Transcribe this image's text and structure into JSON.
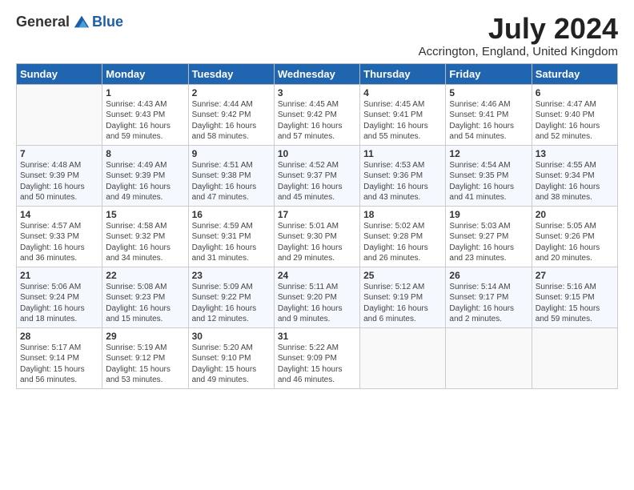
{
  "logo": {
    "general": "General",
    "blue": "Blue"
  },
  "title": "July 2024",
  "location": "Accrington, England, United Kingdom",
  "days_header": [
    "Sunday",
    "Monday",
    "Tuesday",
    "Wednesday",
    "Thursday",
    "Friday",
    "Saturday"
  ],
  "weeks": [
    [
      {
        "day": "",
        "sunrise": "",
        "sunset": "",
        "daylight": ""
      },
      {
        "day": "1",
        "sunrise": "Sunrise: 4:43 AM",
        "sunset": "Sunset: 9:43 PM",
        "daylight": "Daylight: 16 hours and 59 minutes."
      },
      {
        "day": "2",
        "sunrise": "Sunrise: 4:44 AM",
        "sunset": "Sunset: 9:42 PM",
        "daylight": "Daylight: 16 hours and 58 minutes."
      },
      {
        "day": "3",
        "sunrise": "Sunrise: 4:45 AM",
        "sunset": "Sunset: 9:42 PM",
        "daylight": "Daylight: 16 hours and 57 minutes."
      },
      {
        "day": "4",
        "sunrise": "Sunrise: 4:45 AM",
        "sunset": "Sunset: 9:41 PM",
        "daylight": "Daylight: 16 hours and 55 minutes."
      },
      {
        "day": "5",
        "sunrise": "Sunrise: 4:46 AM",
        "sunset": "Sunset: 9:41 PM",
        "daylight": "Daylight: 16 hours and 54 minutes."
      },
      {
        "day": "6",
        "sunrise": "Sunrise: 4:47 AM",
        "sunset": "Sunset: 9:40 PM",
        "daylight": "Daylight: 16 hours and 52 minutes."
      }
    ],
    [
      {
        "day": "7",
        "sunrise": "Sunrise: 4:48 AM",
        "sunset": "Sunset: 9:39 PM",
        "daylight": "Daylight: 16 hours and 50 minutes."
      },
      {
        "day": "8",
        "sunrise": "Sunrise: 4:49 AM",
        "sunset": "Sunset: 9:39 PM",
        "daylight": "Daylight: 16 hours and 49 minutes."
      },
      {
        "day": "9",
        "sunrise": "Sunrise: 4:51 AM",
        "sunset": "Sunset: 9:38 PM",
        "daylight": "Daylight: 16 hours and 47 minutes."
      },
      {
        "day": "10",
        "sunrise": "Sunrise: 4:52 AM",
        "sunset": "Sunset: 9:37 PM",
        "daylight": "Daylight: 16 hours and 45 minutes."
      },
      {
        "day": "11",
        "sunrise": "Sunrise: 4:53 AM",
        "sunset": "Sunset: 9:36 PM",
        "daylight": "Daylight: 16 hours and 43 minutes."
      },
      {
        "day": "12",
        "sunrise": "Sunrise: 4:54 AM",
        "sunset": "Sunset: 9:35 PM",
        "daylight": "Daylight: 16 hours and 41 minutes."
      },
      {
        "day": "13",
        "sunrise": "Sunrise: 4:55 AM",
        "sunset": "Sunset: 9:34 PM",
        "daylight": "Daylight: 16 hours and 38 minutes."
      }
    ],
    [
      {
        "day": "14",
        "sunrise": "Sunrise: 4:57 AM",
        "sunset": "Sunset: 9:33 PM",
        "daylight": "Daylight: 16 hours and 36 minutes."
      },
      {
        "day": "15",
        "sunrise": "Sunrise: 4:58 AM",
        "sunset": "Sunset: 9:32 PM",
        "daylight": "Daylight: 16 hours and 34 minutes."
      },
      {
        "day": "16",
        "sunrise": "Sunrise: 4:59 AM",
        "sunset": "Sunset: 9:31 PM",
        "daylight": "Daylight: 16 hours and 31 minutes."
      },
      {
        "day": "17",
        "sunrise": "Sunrise: 5:01 AM",
        "sunset": "Sunset: 9:30 PM",
        "daylight": "Daylight: 16 hours and 29 minutes."
      },
      {
        "day": "18",
        "sunrise": "Sunrise: 5:02 AM",
        "sunset": "Sunset: 9:28 PM",
        "daylight": "Daylight: 16 hours and 26 minutes."
      },
      {
        "day": "19",
        "sunrise": "Sunrise: 5:03 AM",
        "sunset": "Sunset: 9:27 PM",
        "daylight": "Daylight: 16 hours and 23 minutes."
      },
      {
        "day": "20",
        "sunrise": "Sunrise: 5:05 AM",
        "sunset": "Sunset: 9:26 PM",
        "daylight": "Daylight: 16 hours and 20 minutes."
      }
    ],
    [
      {
        "day": "21",
        "sunrise": "Sunrise: 5:06 AM",
        "sunset": "Sunset: 9:24 PM",
        "daylight": "Daylight: 16 hours and 18 minutes."
      },
      {
        "day": "22",
        "sunrise": "Sunrise: 5:08 AM",
        "sunset": "Sunset: 9:23 PM",
        "daylight": "Daylight: 16 hours and 15 minutes."
      },
      {
        "day": "23",
        "sunrise": "Sunrise: 5:09 AM",
        "sunset": "Sunset: 9:22 PM",
        "daylight": "Daylight: 16 hours and 12 minutes."
      },
      {
        "day": "24",
        "sunrise": "Sunrise: 5:11 AM",
        "sunset": "Sunset: 9:20 PM",
        "daylight": "Daylight: 16 hours and 9 minutes."
      },
      {
        "day": "25",
        "sunrise": "Sunrise: 5:12 AM",
        "sunset": "Sunset: 9:19 PM",
        "daylight": "Daylight: 16 hours and 6 minutes."
      },
      {
        "day": "26",
        "sunrise": "Sunrise: 5:14 AM",
        "sunset": "Sunset: 9:17 PM",
        "daylight": "Daylight: 16 hours and 2 minutes."
      },
      {
        "day": "27",
        "sunrise": "Sunrise: 5:16 AM",
        "sunset": "Sunset: 9:15 PM",
        "daylight": "Daylight: 15 hours and 59 minutes."
      }
    ],
    [
      {
        "day": "28",
        "sunrise": "Sunrise: 5:17 AM",
        "sunset": "Sunset: 9:14 PM",
        "daylight": "Daylight: 15 hours and 56 minutes."
      },
      {
        "day": "29",
        "sunrise": "Sunrise: 5:19 AM",
        "sunset": "Sunset: 9:12 PM",
        "daylight": "Daylight: 15 hours and 53 minutes."
      },
      {
        "day": "30",
        "sunrise": "Sunrise: 5:20 AM",
        "sunset": "Sunset: 9:10 PM",
        "daylight": "Daylight: 15 hours and 49 minutes."
      },
      {
        "day": "31",
        "sunrise": "Sunrise: 5:22 AM",
        "sunset": "Sunset: 9:09 PM",
        "daylight": "Daylight: 15 hours and 46 minutes."
      },
      {
        "day": "",
        "sunrise": "",
        "sunset": "",
        "daylight": ""
      },
      {
        "day": "",
        "sunrise": "",
        "sunset": "",
        "daylight": ""
      },
      {
        "day": "",
        "sunrise": "",
        "sunset": "",
        "daylight": ""
      }
    ]
  ]
}
